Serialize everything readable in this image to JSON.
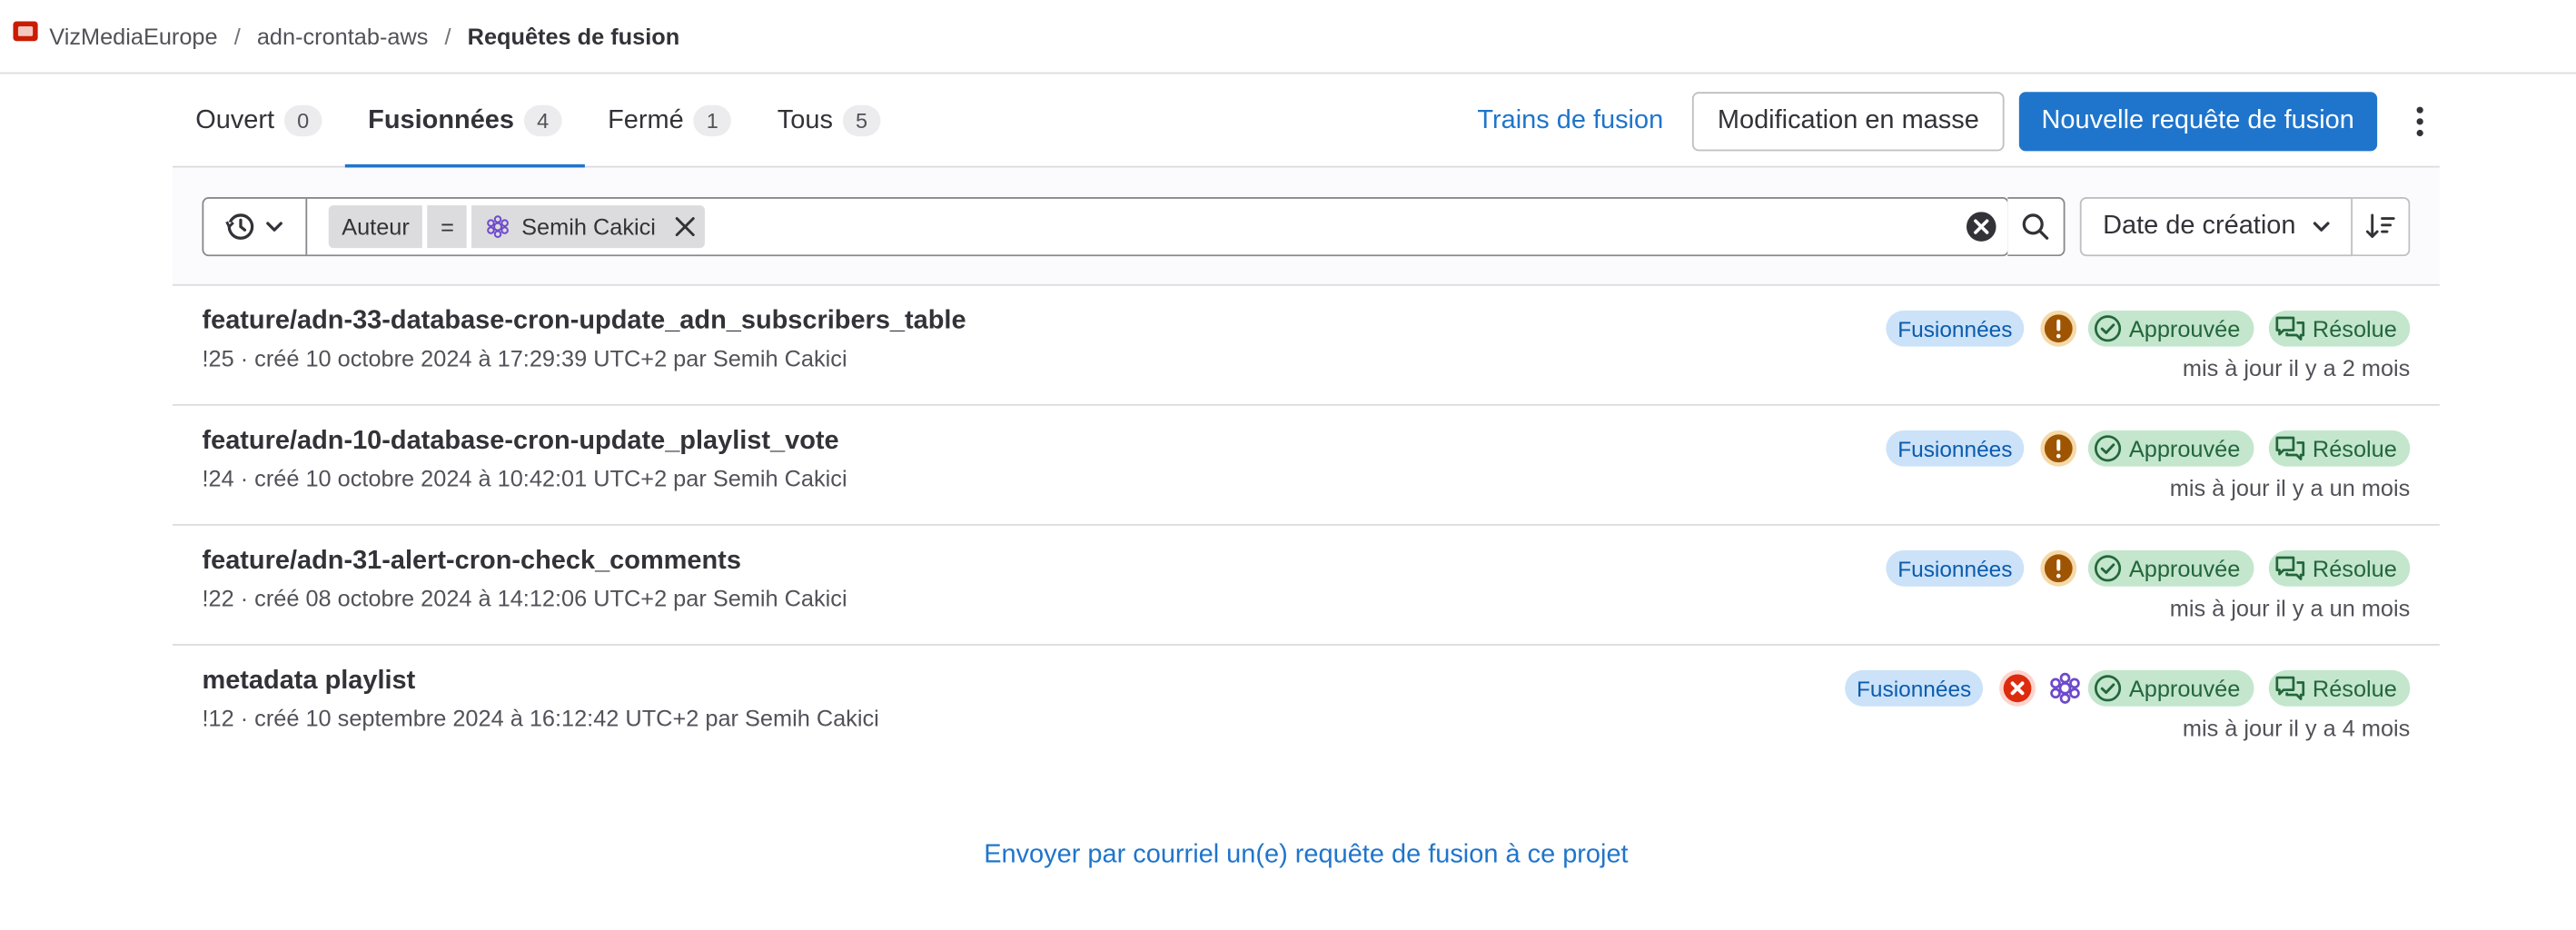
{
  "breadcrumb": {
    "group": "VizMediaEurope",
    "project": "adn-crontab-aws",
    "current": "Requêtes de fusion",
    "separator": "/"
  },
  "tabs": [
    {
      "label": "Ouvert",
      "count": "0",
      "active": false
    },
    {
      "label": "Fusionnées",
      "count": "4",
      "active": true
    },
    {
      "label": "Fermé",
      "count": "1",
      "active": false
    },
    {
      "label": "Tous",
      "count": "5",
      "active": false
    }
  ],
  "actions": {
    "merge_trains": "Trains de fusion",
    "bulk_edit": "Modification en masse",
    "new_mr": "Nouvelle requête de fusion"
  },
  "filter": {
    "token_key": "Auteur",
    "token_op": "=",
    "token_value": "Semih Cakici",
    "sort_label": "Date de création"
  },
  "merge_requests": [
    {
      "title": "feature/adn-33-database-cron-update_adn_subscribers_table",
      "meta": "!25 · créé 10 octobre 2024 à 17:29:39 UTC+2 par ",
      "author": "Semih Cakici",
      "status": "Fusionnées",
      "pipeline": "warning",
      "approved": "Approuvée",
      "resolved": "Résolue",
      "updated": "mis à jour il y a 2 mois"
    },
    {
      "title": "feature/adn-10-database-cron-update_playlist_vote",
      "meta": "!24 · créé 10 octobre 2024 à 10:42:01 UTC+2 par ",
      "author": "Semih Cakici",
      "status": "Fusionnées",
      "pipeline": "warning",
      "approved": "Approuvée",
      "resolved": "Résolue",
      "updated": "mis à jour il y a un mois"
    },
    {
      "title": "feature/adn-31-alert-cron-check_comments",
      "meta": "!22 · créé 08 octobre 2024 à 14:12:06 UTC+2 par ",
      "author": "Semih Cakici",
      "status": "Fusionnées",
      "pipeline": "warning",
      "approved": "Approuvée",
      "resolved": "Résolue",
      "updated": "mis à jour il y a un mois"
    },
    {
      "title": "metadata playlist",
      "meta": "!12 · créé 10 septembre 2024 à 16:12:42 UTC+2 par ",
      "author": "Semih Cakici",
      "status": "Fusionnées",
      "pipeline": "failed",
      "approved": "Approuvée",
      "resolved": "Résolue",
      "updated": "mis à jour il y a 4 mois"
    }
  ],
  "footer": {
    "email_link": "Envoyer par courriel un(e) requête de fusion à ce projet"
  },
  "colors": {
    "accent": "#1f75cb",
    "warning": "#c17d10",
    "danger": "#dd2b0e",
    "success": "#108548"
  }
}
